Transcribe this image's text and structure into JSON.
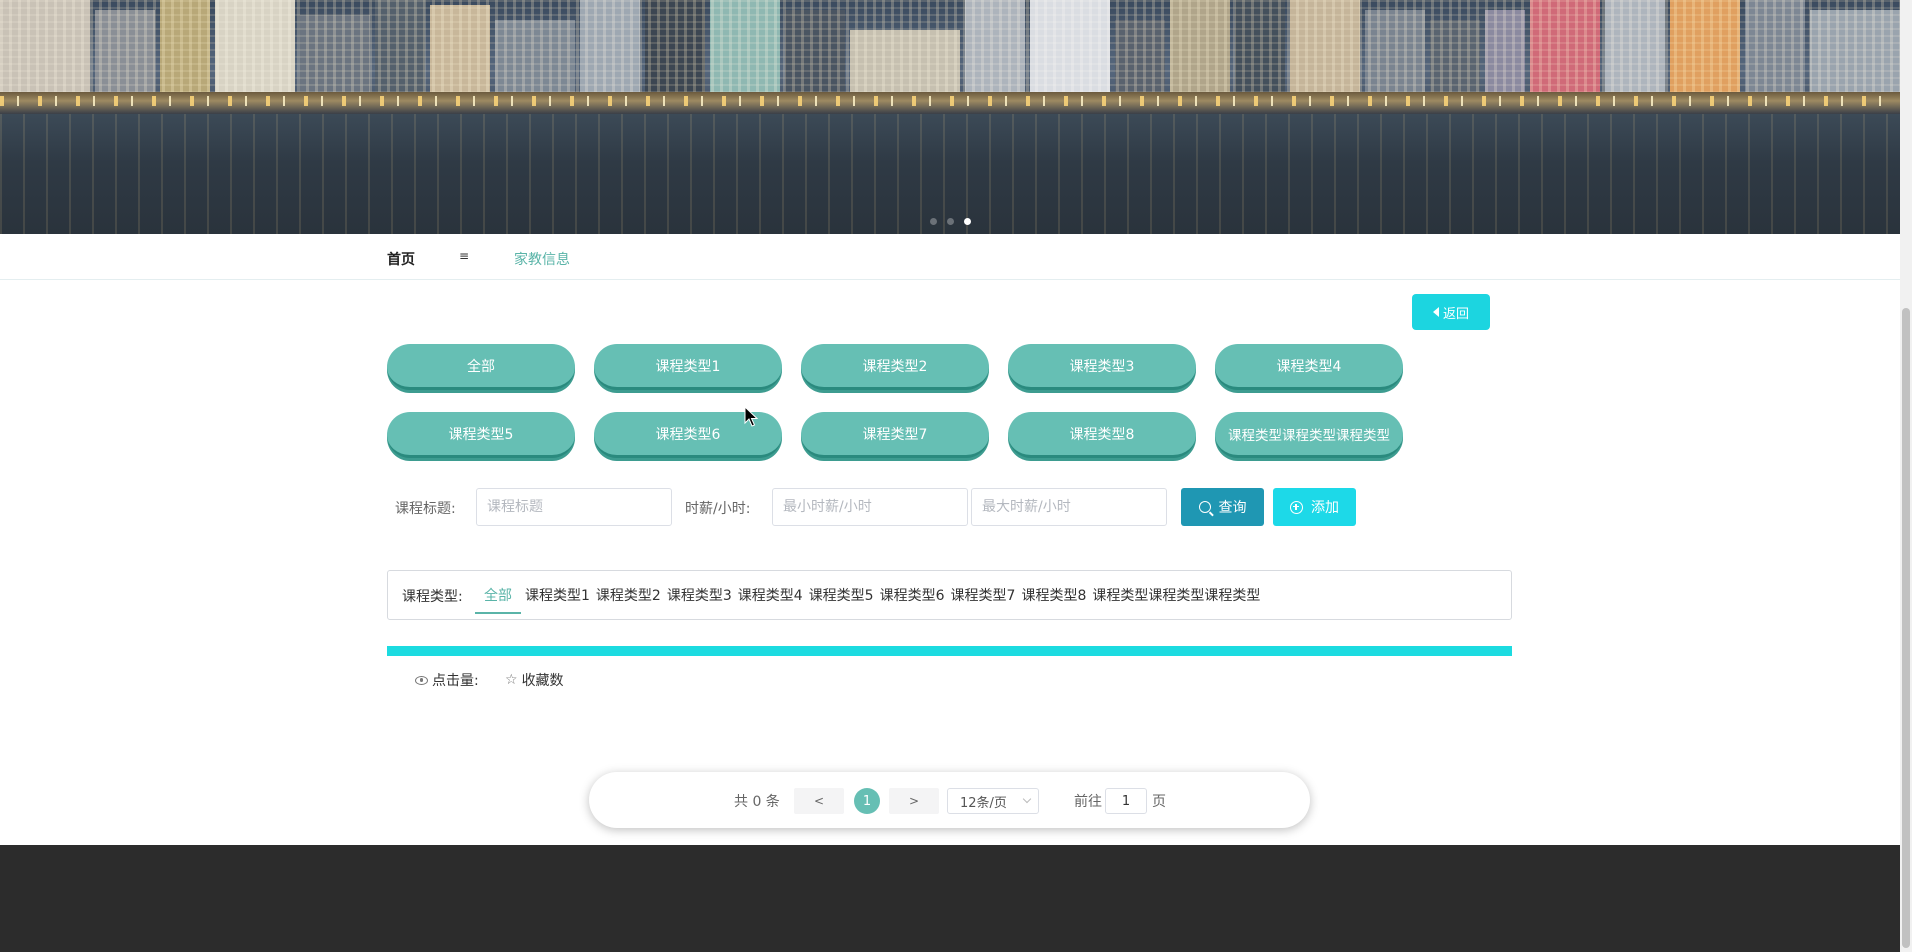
{
  "nav": {
    "home": "首页",
    "menu_icon": "≡",
    "current": "家教信息"
  },
  "back_button": {
    "label": "返回"
  },
  "category_pills": [
    "全部",
    "课程类型1",
    "课程类型2",
    "课程类型3",
    "课程类型4",
    "课程类型5",
    "课程类型6",
    "课程类型7",
    "课程类型8",
    "课程类型课程类型课程类型"
  ],
  "search": {
    "title_label": "课程标题:",
    "title_placeholder": "课程标题",
    "wage_label": "时薪/小时:",
    "min_placeholder": "最小时薪/小时",
    "max_placeholder": "最大时薪/小时",
    "query_button": "查询",
    "add_button": "添加"
  },
  "filter": {
    "label": "课程类型:",
    "items": [
      "全部",
      "课程类型1",
      "课程类型2",
      "课程类型3",
      "课程类型4",
      "课程类型5",
      "课程类型6",
      "课程类型7",
      "课程类型8",
      "课程类型课程类型课程类型"
    ],
    "active_index": 0
  },
  "stats": {
    "clicks_label": "点击量:",
    "favorites_label": "收藏数"
  },
  "pagination": {
    "total": "共 0 条",
    "prev": "<",
    "current_page": "1",
    "next": ">",
    "page_size": "12条/页",
    "goto_label": "前往",
    "goto_value": "1",
    "page_suffix": "页"
  },
  "colors": {
    "accent": "#66bfb4",
    "cyan": "#1cd5e0",
    "query_blue": "#1f97b3",
    "footer": "#2c2c2c"
  },
  "carousel": {
    "slide_count": 3,
    "active_index": 2
  }
}
